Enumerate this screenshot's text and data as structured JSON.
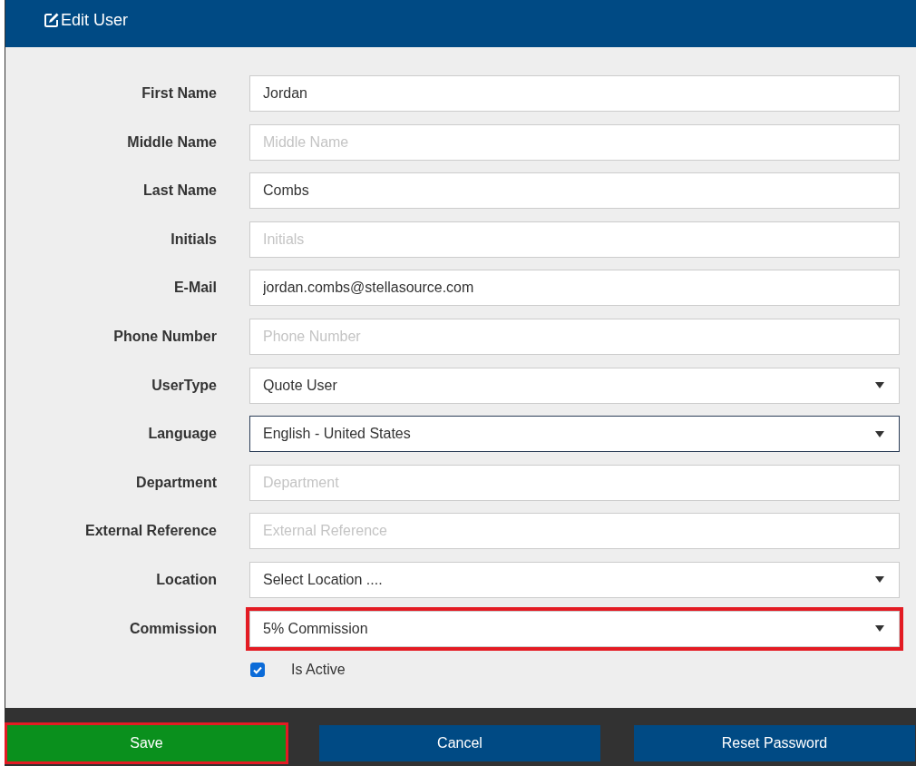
{
  "header": {
    "title": "Edit User"
  },
  "fields": [
    {
      "label": "First Name",
      "kind": "text",
      "value": "Jordan",
      "focused": false,
      "highlighted": false
    },
    {
      "label": "Middle Name",
      "kind": "text",
      "placeholder": "Middle Name",
      "focused": false,
      "highlighted": false
    },
    {
      "label": "Last Name",
      "kind": "text",
      "value": "Combs",
      "focused": false,
      "highlighted": false
    },
    {
      "label": "Initials",
      "kind": "text",
      "placeholder": "Initials",
      "focused": false,
      "highlighted": false
    },
    {
      "label": "E-Mail",
      "kind": "text",
      "value": "jordan.combs@stellasource.com",
      "focused": false,
      "highlighted": false
    },
    {
      "label": "Phone Number",
      "kind": "text",
      "placeholder": "Phone Number",
      "focused": false,
      "highlighted": false
    },
    {
      "label": "UserType",
      "kind": "select",
      "value": "Quote User",
      "focused": false,
      "highlighted": false
    },
    {
      "label": "Language",
      "kind": "select",
      "value": "English - United States",
      "focused": true,
      "highlighted": false
    },
    {
      "label": "Department",
      "kind": "text",
      "placeholder": "Department",
      "focused": false,
      "highlighted": false
    },
    {
      "label": "External Reference",
      "kind": "text",
      "placeholder": "External Reference",
      "focused": false,
      "highlighted": false
    },
    {
      "label": "Location",
      "kind": "select",
      "value": "Select Location ....",
      "focused": false,
      "highlighted": false
    },
    {
      "label": "Commission",
      "kind": "select",
      "value": "5% Commission",
      "focused": false,
      "highlighted": true
    }
  ],
  "is_active": {
    "label": "Is Active",
    "checked": true
  },
  "buttons": [
    {
      "label": "Save",
      "kind": "primary",
      "highlighted": true
    },
    {
      "label": "Cancel",
      "kind": "secondary",
      "highlighted": false
    },
    {
      "label": "Reset Password",
      "kind": "secondary",
      "highlighted": false
    }
  ]
}
